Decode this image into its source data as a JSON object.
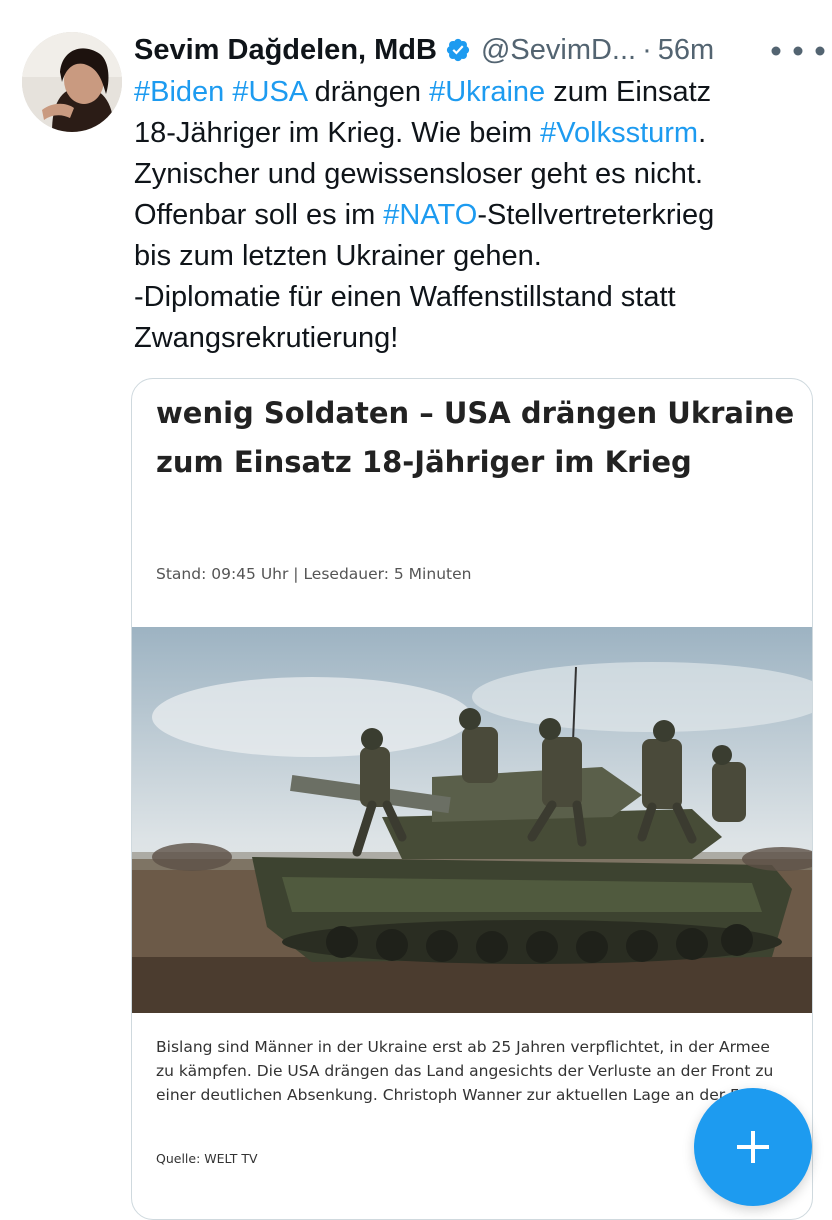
{
  "tweet": {
    "author_name": "Sevim Dağdelen, MdB",
    "handle": "@SevimD...",
    "separator": "·",
    "time": "56m",
    "text_lines": [
      [
        {
          "t": "#Biden",
          "tag": true
        },
        {
          "t": " ",
          "tag": false
        },
        {
          "t": "#USA",
          "tag": true
        },
        {
          "t": " drängen ",
          "tag": false
        },
        {
          "t": "#Ukraine",
          "tag": true
        },
        {
          "t": " zum Einsatz",
          "tag": false
        }
      ],
      [
        {
          "t": "18-Jähriger im Krieg. Wie beim ",
          "tag": false
        },
        {
          "t": "#Volkssturm",
          "tag": true
        },
        {
          "t": ".",
          "tag": false
        }
      ],
      [
        {
          "t": "Zynischer und gewissensloser geht es nicht.",
          "tag": false
        }
      ],
      [
        {
          "t": "Offenbar soll es im ",
          "tag": false
        },
        {
          "t": "#NATO",
          "tag": true
        },
        {
          "t": "-Stellvertreterkrieg",
          "tag": false
        }
      ],
      [
        {
          "t": "bis zum letzten Ukrainer gehen.",
          "tag": false
        }
      ],
      [
        {
          "t": "-Diplomatie für einen Waffenstillstand statt",
          "tag": false
        }
      ],
      [
        {
          "t": "Zwangsrekrutierung!",
          "tag": false
        }
      ]
    ]
  },
  "card": {
    "title": "wenig Soldaten – USA drängen Ukraine zum Einsatz 18-Jähriger im Krieg",
    "meta": "Stand: 09:45 Uhr | Lesedauer: 5 Minuten",
    "caption": "Bislang sind Männer in der Ukraine erst ab 25 Jahren verpflichtet, in der Armee zu kämpfen. Die USA drängen das Land angesichts der Verluste an der Front zu einer deutlichen Absenkung. Christoph Wanner zur aktuellen Lage an der Front.",
    "source": "Quelle: WELT TV",
    "image_icon": "tank-soldiers-photo"
  },
  "icons": {
    "verified": "verified-badge-icon",
    "more": "more-icon",
    "compose": "plus-icon"
  },
  "colors": {
    "accent": "#1d9bf0",
    "secondary_text": "#536471",
    "border": "#cfd9de"
  }
}
